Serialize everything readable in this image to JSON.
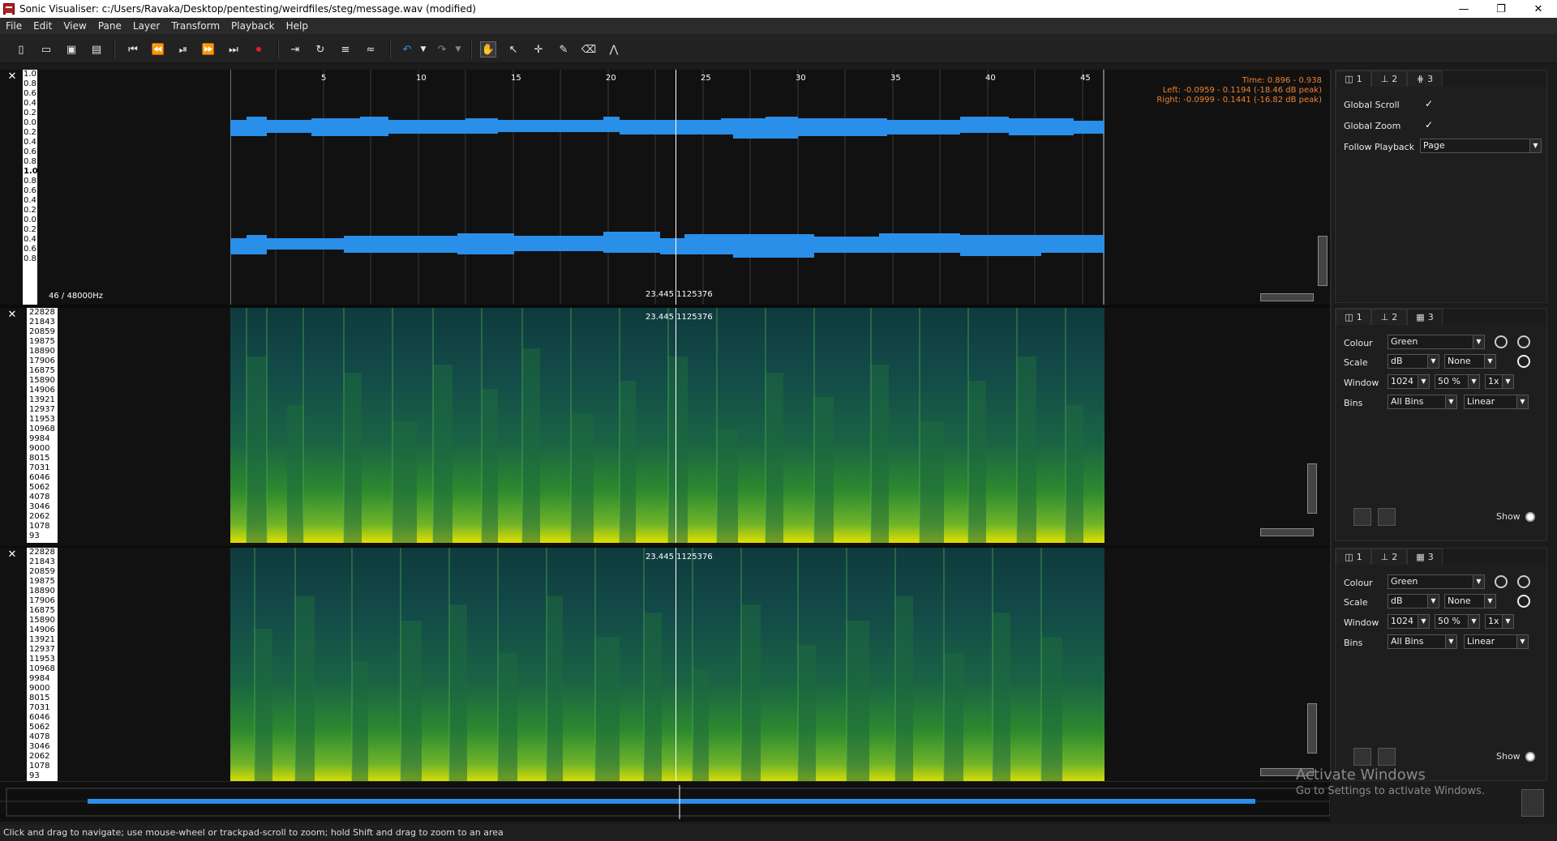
{
  "window": {
    "title": "Sonic Visualiser: c:/Users/Ravaka/Desktop/pentesting/weirdfiles/steg/message.wav (modified)",
    "minimize": "—",
    "restore": "❐",
    "close": "✕"
  },
  "menu": [
    "File",
    "Edit",
    "View",
    "Pane",
    "Layer",
    "Transform",
    "Playback",
    "Help"
  ],
  "toolbar": {
    "icons": [
      "new-icon",
      "open-icon",
      "save-icon",
      "save-session-icon",
      "rewind-start-icon",
      "rewind-icon",
      "play-pause-icon",
      "fast-forward-icon",
      "fast-forward-end-icon",
      "record-icon",
      "constrain-playback-icon",
      "loop-icon",
      "solo-icon",
      "align-icon",
      "undo-icon",
      "redo-icon",
      "navigate-icon",
      "select-icon",
      "move-icon",
      "draw-icon",
      "erase-icon",
      "measure-icon"
    ]
  },
  "waveform_pane": {
    "scale_labels": [
      "1.0",
      "0.8",
      "0.6",
      "0.4",
      "0.2",
      "0.0",
      "0.2",
      "0.4",
      "0.6",
      "0.8",
      "1.0",
      "0.8",
      "0.6",
      "0.4",
      "0.2",
      "0.0",
      "0.2",
      "0.4",
      "0.6",
      "0.8"
    ],
    "ruler_ticks": [
      "5",
      "10",
      "15",
      "20",
      "25",
      "30",
      "35",
      "40",
      "45"
    ],
    "rate_label": "46 / 48000Hz",
    "cursor_label": "23.445  1125376",
    "info": {
      "time": "Time: 0.896 - 0.938",
      "left": "Left: -0.0959 - 0.1194 (-18.46 dB peak)",
      "right": "Right: -0.0999 - 0.1441 (-16.82 dB peak)"
    }
  },
  "spectrogram_scale": [
    "22828",
    "21843",
    "20859",
    "19875",
    "18890",
    "17906",
    "16875",
    "15890",
    "14906",
    "13921",
    "12937",
    "11953",
    "10968",
    "9984",
    "9000",
    "8015",
    "7031",
    "6046",
    "5062",
    "4078",
    "3046",
    "2062",
    "1078",
    "93"
  ],
  "spectrogram_cursor_label": "23.445  1125376",
  "panel_top": {
    "tabs": [
      "1",
      "2",
      "3"
    ],
    "global_scroll_label": "Global Scroll",
    "global_scroll": true,
    "global_zoom_label": "Global Zoom",
    "global_zoom": true,
    "follow_playback_label": "Follow Playback",
    "follow_playback_value": "Page"
  },
  "panel_spec": {
    "tabs": [
      "1",
      "2",
      "3"
    ],
    "colour_label": "Colour",
    "colour_value": "Green",
    "scale_label": "Scale",
    "scale_value": "dB",
    "normalize_value": "None",
    "window_label": "Window",
    "window_value": "1024",
    "overlap_value": "50 %",
    "oversample_value": "1x",
    "bins_label": "Bins",
    "bins_value": "All Bins",
    "bins_scale_value": "Linear",
    "show_label": "Show"
  },
  "watermark": {
    "line1": "Activate Windows",
    "line2": "Go to Settings to activate Windows."
  },
  "status": "Click and drag to navigate; use mouse-wheel or trackpad-scroll to zoom; hold Shift and drag to zoom to an area",
  "colors": {
    "waveform": "#2a8fe8",
    "spectrogram_low": "#0f3a3d",
    "spectrogram_high": "#e0e000",
    "info_text": "#f08030"
  }
}
